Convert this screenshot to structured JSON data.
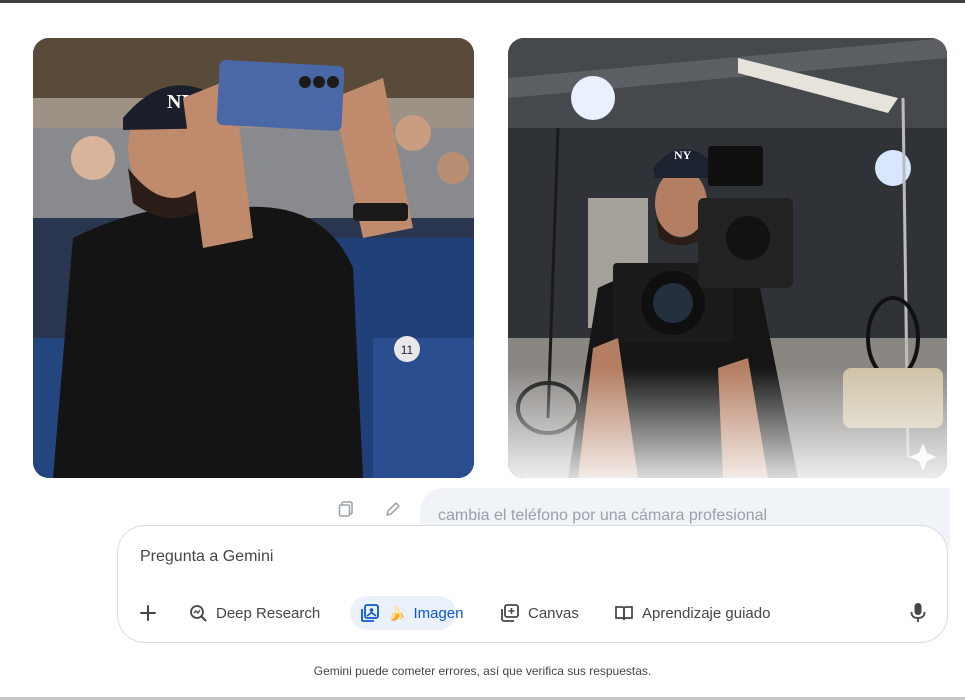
{
  "images": {
    "left": {
      "cap_logo": "NY",
      "seat_number": "11"
    },
    "right": {
      "cap_logo": "NY"
    }
  },
  "user_message": "cambia el teléfono por una cámara profesional",
  "input": {
    "placeholder": "Pregunta a Gemini"
  },
  "toolbar": {
    "add_icon": "plus-icon",
    "deep_research": "Deep Research",
    "imagen_emoji": "🍌",
    "imagen": "Imagen",
    "canvas": "Canvas",
    "guided": "Aprendizaje guiado",
    "mic_icon": "microphone-icon"
  },
  "disclaimer": "Gemini puede cometer errores, así que verifica sus respuestas.",
  "colors": {
    "accent": "#0b57d0",
    "chip_bg": "#eaf1fb",
    "bubble_bg": "#f0f4f9"
  }
}
